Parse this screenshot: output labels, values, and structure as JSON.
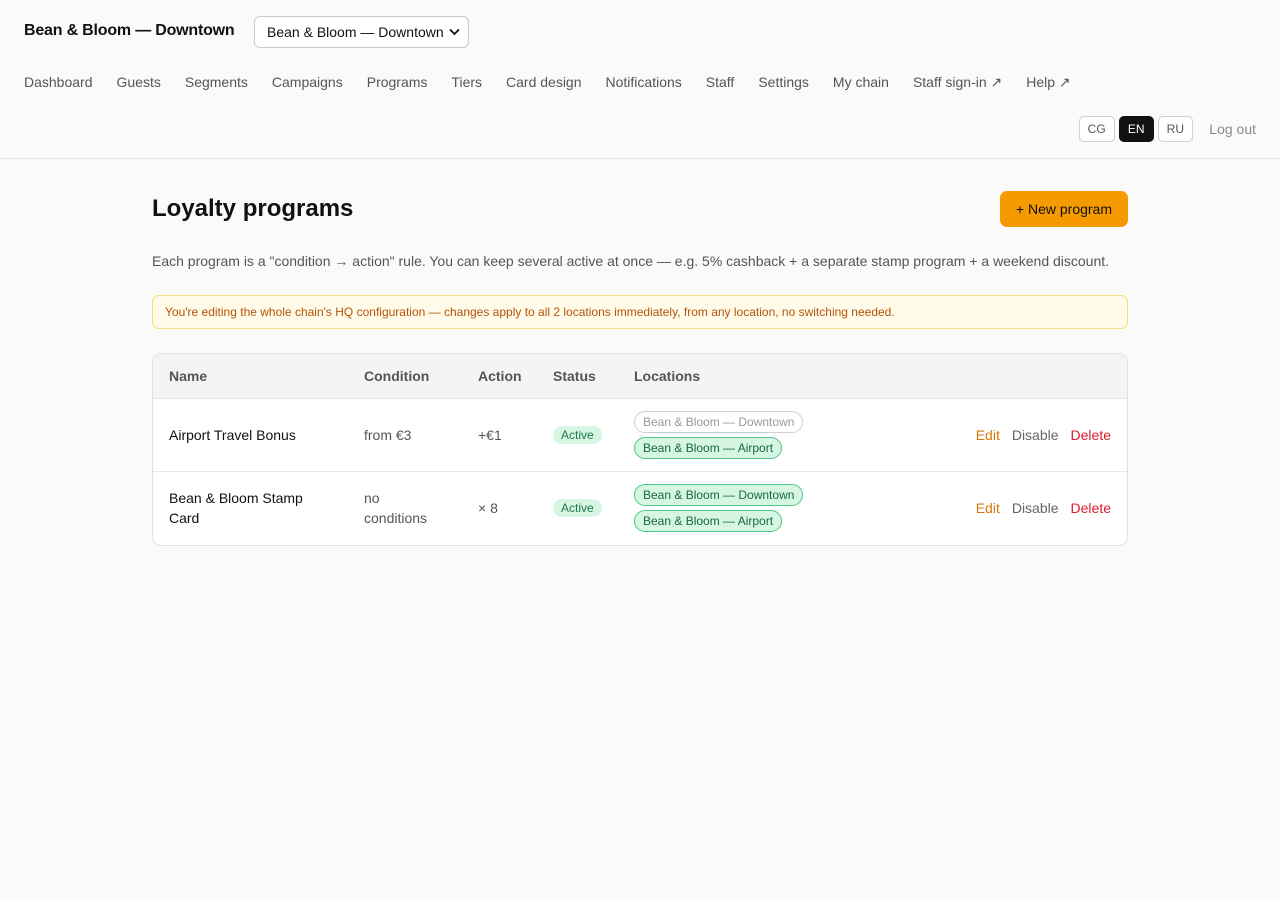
{
  "header": {
    "brand": "Bean & Bloom — Downtown",
    "location_select": {
      "value": "Bean & Bloom — Downtown"
    },
    "nav": [
      {
        "label": "Dashboard"
      },
      {
        "label": "Guests"
      },
      {
        "label": "Segments"
      },
      {
        "label": "Campaigns"
      },
      {
        "label": "Programs"
      },
      {
        "label": "Tiers"
      },
      {
        "label": "Card design"
      },
      {
        "label": "Notifications"
      },
      {
        "label": "Staff"
      },
      {
        "label": "Settings"
      },
      {
        "label": "My chain"
      },
      {
        "label": "Staff sign-in ↗"
      },
      {
        "label": "Help ↗"
      }
    ],
    "languages": [
      "CG",
      "EN",
      "RU"
    ],
    "active_language": "EN",
    "logout_label": "Log out"
  },
  "main": {
    "title": "Loyalty programs",
    "new_button_label": "+ New program",
    "description": "Each program is a \"condition → action\" rule. You can keep several active at once — e.g. 5% cashback + a separate stamp program + a weekend discount.",
    "notice": "You're editing the whole chain's HQ configuration — changes apply to all 2 locations immediately, from any location, no switching needed."
  },
  "table": {
    "columns": {
      "name": "Name",
      "condition": "Condition",
      "action": "Action",
      "status": "Status",
      "locations": "Locations"
    },
    "rows": [
      {
        "name": "Airport Travel Bonus",
        "condition": "from €3",
        "action": "+€1",
        "status": "Active",
        "locations": [
          {
            "label": "Bean & Bloom — Downtown",
            "enabled": false
          },
          {
            "label": "Bean & Bloom — Airport",
            "enabled": true
          }
        ],
        "edit": "Edit",
        "disable": "Disable",
        "delete": "Delete"
      },
      {
        "name": "Bean & Bloom Stamp Card",
        "condition": "no conditions",
        "action": "× 8",
        "status": "Active",
        "locations": [
          {
            "label": "Bean & Bloom — Downtown",
            "enabled": true
          },
          {
            "label": "Bean & Bloom — Airport",
            "enabled": true
          }
        ],
        "edit": "Edit",
        "disable": "Disable",
        "delete": "Delete"
      }
    ]
  },
  "colors": {
    "accent": "#f59a00",
    "active_badge_bg": "#d6f5e3",
    "active_badge_text": "#1a7a45",
    "notice_bg": "#fffbe8",
    "notice_text": "#b4530a",
    "delete": "#dc1c2c",
    "edit": "#d97706"
  },
  "icons": {
    "select_chevron": "chevron-down-icon"
  }
}
